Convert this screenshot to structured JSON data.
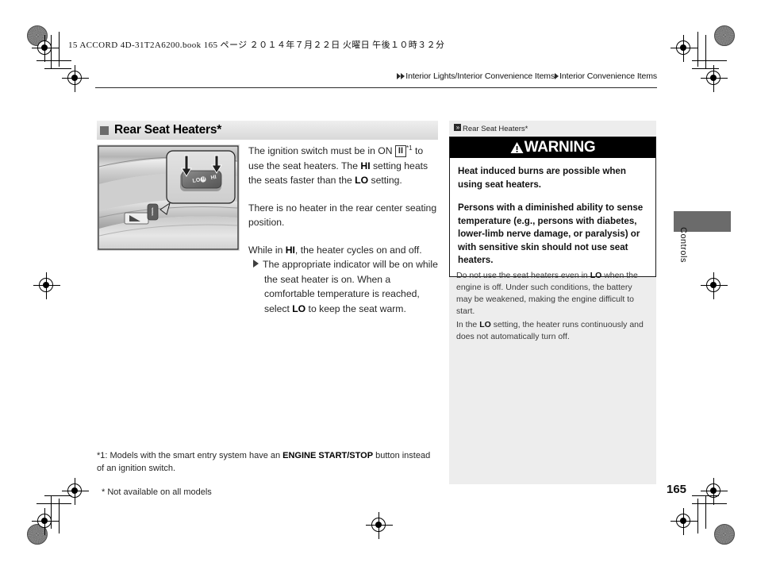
{
  "print": {
    "book_line": "15 ACCORD 4D-31T2A6200.book   165 ページ   ２０１４年７月２２日   火曜日   午後１０時３２分"
  },
  "breadcrumb": {
    "part1": "Interior Lights/Interior Convenience Items",
    "part2": "Interior Convenience Items"
  },
  "section": {
    "title": "Rear Seat Heaters*"
  },
  "figure": {
    "caption_alt": "Rear door armrest with seat heater switch and LO / HI callout",
    "switch_labels": {
      "lo": "LO",
      "hi": "HI"
    }
  },
  "body": {
    "p1_a": "The ignition switch must be in ON ",
    "p1_key": "II",
    "p1_sup": "*1",
    "p1_b": " to use the seat heaters. The ",
    "p1_hi": "HI",
    "p1_c": " setting heats the seats faster than the ",
    "p1_lo": "LO",
    "p1_d": " setting.",
    "p2": "There is no heater in the rear center seating position.",
    "p3_a": "While in ",
    "p3_hi": "HI",
    "p3_b": ", the heater cycles on and off.",
    "p3_bullet_a": "The appropriate indicator will be on while the seat heater is on. When a comfortable temperature is reached, select ",
    "p3_bullet_lo": "LO",
    "p3_bullet_b": " to keep the seat warm."
  },
  "footnote": {
    "line_a": "*1: Models with the smart entry system have an ",
    "line_bold": "ENGINE START/STOP",
    "line_b": " button instead of an ignition switch.",
    "not_available": "* Not available on all models"
  },
  "side_panel": {
    "reference": "Rear Seat Heaters*",
    "warning": {
      "title": "WARNING",
      "icon": "warning-triangle-icon",
      "p1": "Heat induced burns are possible when using seat heaters.",
      "p2": "Persons with a diminished ability to sense temperature (e.g., persons with diabetes, lower-limb nerve damage, or paralysis) or with sensitive skin should not use seat heaters."
    },
    "note1_a": "Do not use the seat heaters even in ",
    "note1_lo": "LO",
    "note1_b": " when the engine is off. Under such conditions, the battery may be weakened, making the engine difficult to start.",
    "note2_a": "In the ",
    "note2_lo": "LO",
    "note2_b": " setting, the heater runs continuously and does not automatically turn off."
  },
  "thumb_tab": {
    "label": "Controls"
  },
  "page": {
    "number": "165"
  },
  "colors": {
    "warning_bar": "#000000",
    "panel_bg": "#ededed",
    "section_head_bg": "#e4e4e4",
    "thumb_tab": "#6b6b6b"
  }
}
